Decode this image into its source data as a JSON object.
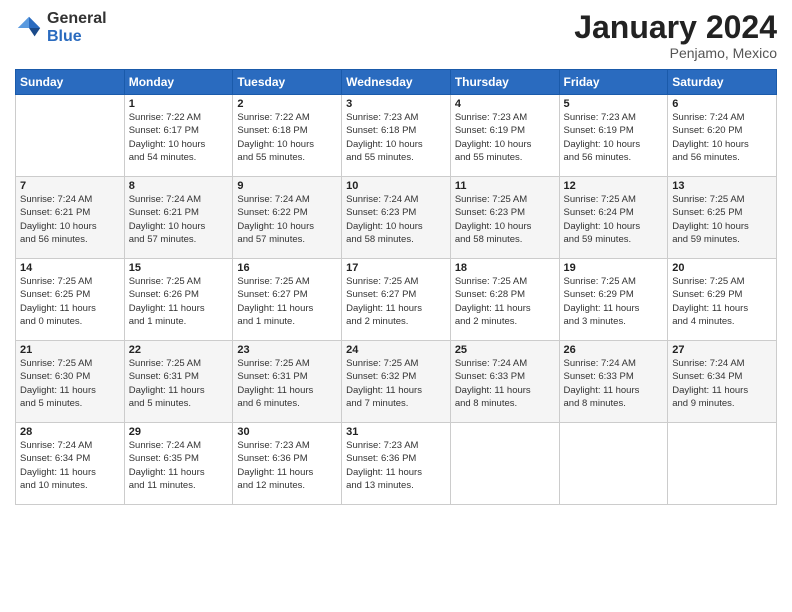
{
  "logo": {
    "general": "General",
    "blue": "Blue"
  },
  "title": "January 2024",
  "location": "Penjamo, Mexico",
  "days_header": [
    "Sunday",
    "Monday",
    "Tuesday",
    "Wednesday",
    "Thursday",
    "Friday",
    "Saturday"
  ],
  "weeks": [
    [
      {
        "num": "",
        "info": ""
      },
      {
        "num": "1",
        "info": "Sunrise: 7:22 AM\nSunset: 6:17 PM\nDaylight: 10 hours\nand 54 minutes."
      },
      {
        "num": "2",
        "info": "Sunrise: 7:22 AM\nSunset: 6:18 PM\nDaylight: 10 hours\nand 55 minutes."
      },
      {
        "num": "3",
        "info": "Sunrise: 7:23 AM\nSunset: 6:18 PM\nDaylight: 10 hours\nand 55 minutes."
      },
      {
        "num": "4",
        "info": "Sunrise: 7:23 AM\nSunset: 6:19 PM\nDaylight: 10 hours\nand 55 minutes."
      },
      {
        "num": "5",
        "info": "Sunrise: 7:23 AM\nSunset: 6:19 PM\nDaylight: 10 hours\nand 56 minutes."
      },
      {
        "num": "6",
        "info": "Sunrise: 7:24 AM\nSunset: 6:20 PM\nDaylight: 10 hours\nand 56 minutes."
      }
    ],
    [
      {
        "num": "7",
        "info": "Sunrise: 7:24 AM\nSunset: 6:21 PM\nDaylight: 10 hours\nand 56 minutes."
      },
      {
        "num": "8",
        "info": "Sunrise: 7:24 AM\nSunset: 6:21 PM\nDaylight: 10 hours\nand 57 minutes."
      },
      {
        "num": "9",
        "info": "Sunrise: 7:24 AM\nSunset: 6:22 PM\nDaylight: 10 hours\nand 57 minutes."
      },
      {
        "num": "10",
        "info": "Sunrise: 7:24 AM\nSunset: 6:23 PM\nDaylight: 10 hours\nand 58 minutes."
      },
      {
        "num": "11",
        "info": "Sunrise: 7:25 AM\nSunset: 6:23 PM\nDaylight: 10 hours\nand 58 minutes."
      },
      {
        "num": "12",
        "info": "Sunrise: 7:25 AM\nSunset: 6:24 PM\nDaylight: 10 hours\nand 59 minutes."
      },
      {
        "num": "13",
        "info": "Sunrise: 7:25 AM\nSunset: 6:25 PM\nDaylight: 10 hours\nand 59 minutes."
      }
    ],
    [
      {
        "num": "14",
        "info": "Sunrise: 7:25 AM\nSunset: 6:25 PM\nDaylight: 11 hours\nand 0 minutes."
      },
      {
        "num": "15",
        "info": "Sunrise: 7:25 AM\nSunset: 6:26 PM\nDaylight: 11 hours\nand 1 minute."
      },
      {
        "num": "16",
        "info": "Sunrise: 7:25 AM\nSunset: 6:27 PM\nDaylight: 11 hours\nand 1 minute."
      },
      {
        "num": "17",
        "info": "Sunrise: 7:25 AM\nSunset: 6:27 PM\nDaylight: 11 hours\nand 2 minutes."
      },
      {
        "num": "18",
        "info": "Sunrise: 7:25 AM\nSunset: 6:28 PM\nDaylight: 11 hours\nand 2 minutes."
      },
      {
        "num": "19",
        "info": "Sunrise: 7:25 AM\nSunset: 6:29 PM\nDaylight: 11 hours\nand 3 minutes."
      },
      {
        "num": "20",
        "info": "Sunrise: 7:25 AM\nSunset: 6:29 PM\nDaylight: 11 hours\nand 4 minutes."
      }
    ],
    [
      {
        "num": "21",
        "info": "Sunrise: 7:25 AM\nSunset: 6:30 PM\nDaylight: 11 hours\nand 5 minutes."
      },
      {
        "num": "22",
        "info": "Sunrise: 7:25 AM\nSunset: 6:31 PM\nDaylight: 11 hours\nand 5 minutes."
      },
      {
        "num": "23",
        "info": "Sunrise: 7:25 AM\nSunset: 6:31 PM\nDaylight: 11 hours\nand 6 minutes."
      },
      {
        "num": "24",
        "info": "Sunrise: 7:25 AM\nSunset: 6:32 PM\nDaylight: 11 hours\nand 7 minutes."
      },
      {
        "num": "25",
        "info": "Sunrise: 7:24 AM\nSunset: 6:33 PM\nDaylight: 11 hours\nand 8 minutes."
      },
      {
        "num": "26",
        "info": "Sunrise: 7:24 AM\nSunset: 6:33 PM\nDaylight: 11 hours\nand 8 minutes."
      },
      {
        "num": "27",
        "info": "Sunrise: 7:24 AM\nSunset: 6:34 PM\nDaylight: 11 hours\nand 9 minutes."
      }
    ],
    [
      {
        "num": "28",
        "info": "Sunrise: 7:24 AM\nSunset: 6:34 PM\nDaylight: 11 hours\nand 10 minutes."
      },
      {
        "num": "29",
        "info": "Sunrise: 7:24 AM\nSunset: 6:35 PM\nDaylight: 11 hours\nand 11 minutes."
      },
      {
        "num": "30",
        "info": "Sunrise: 7:23 AM\nSunset: 6:36 PM\nDaylight: 11 hours\nand 12 minutes."
      },
      {
        "num": "31",
        "info": "Sunrise: 7:23 AM\nSunset: 6:36 PM\nDaylight: 11 hours\nand 13 minutes."
      },
      {
        "num": "",
        "info": ""
      },
      {
        "num": "",
        "info": ""
      },
      {
        "num": "",
        "info": ""
      }
    ]
  ]
}
